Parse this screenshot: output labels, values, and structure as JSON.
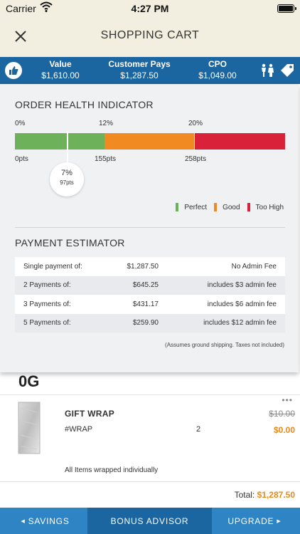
{
  "status_bar": {
    "carrier": "Carrier",
    "time": "4:27 PM"
  },
  "nav": {
    "title": "SHOPPING CART",
    "close_icon": "close-icon"
  },
  "summary": {
    "value_label": "Value",
    "value": "$1,610.00",
    "pays_label": "Customer Pays",
    "pays": "$1,287.50",
    "cpo_label": "CPO",
    "cpo": "$1,049.00"
  },
  "order_health": {
    "title": "ORDER HEALTH INDICATOR",
    "pct_marks": [
      "0%",
      "12%",
      "20%"
    ],
    "pts_marks": [
      "0pts",
      "155pts",
      "258pts"
    ],
    "marker_pct": "7%",
    "marker_pts": "97pts",
    "legend": [
      {
        "label": "Perfect",
        "color": "#6db25a"
      },
      {
        "label": "Good",
        "color": "#f28a22"
      },
      {
        "label": "Too High",
        "color": "#d9213a"
      }
    ]
  },
  "payment_estimator": {
    "title": "PAYMENT ESTIMATOR",
    "rows": [
      {
        "label": "Single payment of:",
        "amount": "$1,287.50",
        "fee": "No Admin Fee"
      },
      {
        "label": "2 Payments of:",
        "amount": "$645.25",
        "fee": "includes $3 admin fee"
      },
      {
        "label": "3 Payments of:",
        "amount": "$431.17",
        "fee": "includes $6 admin fee"
      },
      {
        "label": "5 Payments of:",
        "amount": "$259.90",
        "fee": "includes $12 admin fee"
      }
    ],
    "footnote": "(Assumes ground shipping. Taxes not included)"
  },
  "cart_item": {
    "partial_text": "0G",
    "more": "•••",
    "name": "GIFT WRAP",
    "sku": "#WRAP",
    "qty": "2",
    "original_price": "$10.00",
    "price": "$0.00",
    "note": "All Items wrapped individually"
  },
  "total": {
    "label": "Total:",
    "amount": "$1,287.50"
  },
  "bottom_bar": {
    "savings": "SAVINGS",
    "bonus": "BONUS ADVISOR",
    "upgrade": "UPGRADE"
  },
  "colors": {
    "accent_blue": "#1b66a0",
    "price_orange": "#e88a1a",
    "header_beige": "#f2efe0"
  }
}
